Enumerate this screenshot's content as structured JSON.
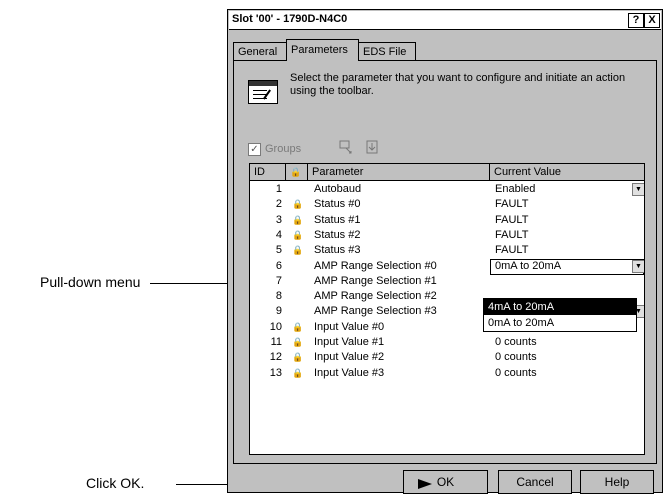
{
  "window": {
    "title": "Slot '00' - 1790D-N4C0",
    "help_glyph": "?",
    "close_glyph": "X"
  },
  "tabs": [
    {
      "label": "General",
      "active": false
    },
    {
      "label": "Parameters",
      "active": true
    },
    {
      "label": "EDS File",
      "active": false
    }
  ],
  "instruction": "Select the parameter that you want to configure and initiate an action using the toolbar.",
  "toolbar": {
    "groups_label": "Groups",
    "groups_checked": true,
    "icons": [
      "monitor-icon",
      "download-icon"
    ]
  },
  "table": {
    "headers": {
      "id": "ID",
      "lock": "🔒",
      "parameter": "Parameter",
      "value": "Current Value"
    },
    "rows": [
      {
        "id": "1",
        "locked": false,
        "name": "Autobaud",
        "value": "Enabled",
        "dropdown": true
      },
      {
        "id": "2",
        "locked": true,
        "name": "Status #0",
        "value": "FAULT",
        "dropdown": false
      },
      {
        "id": "3",
        "locked": true,
        "name": "Status #1",
        "value": "FAULT",
        "dropdown": false
      },
      {
        "id": "4",
        "locked": true,
        "name": "Status #2",
        "value": "FAULT",
        "dropdown": false
      },
      {
        "id": "5",
        "locked": true,
        "name": "Status #3",
        "value": "FAULT",
        "dropdown": false
      },
      {
        "id": "6",
        "locked": false,
        "name": "AMP Range Selection #0",
        "value": "0mA to 20mA",
        "dropdown": true,
        "editing": true
      },
      {
        "id": "7",
        "locked": false,
        "name": "AMP Range Selection #1",
        "value": "",
        "dropdown": false
      },
      {
        "id": "8",
        "locked": false,
        "name": "AMP Range Selection #2",
        "value": "",
        "dropdown": false
      },
      {
        "id": "9",
        "locked": false,
        "name": "AMP Range Selection #3",
        "value": "4mA to 20mA",
        "dropdown": true
      },
      {
        "id": "10",
        "locked": true,
        "name": "Input Value #0",
        "value": "0 counts",
        "dropdown": false
      },
      {
        "id": "11",
        "locked": true,
        "name": "Input Value #1",
        "value": "0 counts",
        "dropdown": false
      },
      {
        "id": "12",
        "locked": true,
        "name": "Input Value #2",
        "value": "0 counts",
        "dropdown": false
      },
      {
        "id": "13",
        "locked": true,
        "name": "Input Value #3",
        "value": "0 counts",
        "dropdown": false
      }
    ]
  },
  "dropdown": {
    "options": [
      "4mA to 20mA",
      "0mA to 20mA"
    ],
    "highlighted": 0
  },
  "buttons": {
    "ok": "OK",
    "cancel": "Cancel",
    "help": "Help"
  },
  "callouts": {
    "pulldown": "Pull-down menu",
    "ok": "Click OK."
  }
}
